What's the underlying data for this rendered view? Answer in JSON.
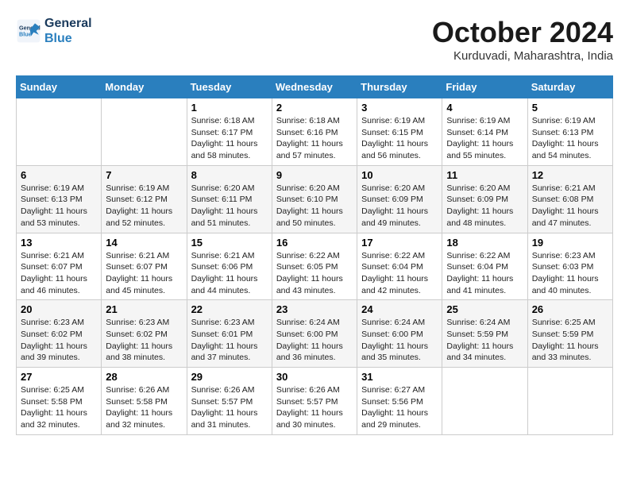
{
  "logo": {
    "line1": "General",
    "line2": "Blue"
  },
  "title": "October 2024",
  "subtitle": "Kurduvadi, Maharashtra, India",
  "days_of_week": [
    "Sunday",
    "Monday",
    "Tuesday",
    "Wednesday",
    "Thursday",
    "Friday",
    "Saturday"
  ],
  "weeks": [
    [
      {
        "day": "",
        "info": ""
      },
      {
        "day": "",
        "info": ""
      },
      {
        "day": "1",
        "info": "Sunrise: 6:18 AM\nSunset: 6:17 PM\nDaylight: 11 hours and 58 minutes."
      },
      {
        "day": "2",
        "info": "Sunrise: 6:18 AM\nSunset: 6:16 PM\nDaylight: 11 hours and 57 minutes."
      },
      {
        "day": "3",
        "info": "Sunrise: 6:19 AM\nSunset: 6:15 PM\nDaylight: 11 hours and 56 minutes."
      },
      {
        "day": "4",
        "info": "Sunrise: 6:19 AM\nSunset: 6:14 PM\nDaylight: 11 hours and 55 minutes."
      },
      {
        "day": "5",
        "info": "Sunrise: 6:19 AM\nSunset: 6:13 PM\nDaylight: 11 hours and 54 minutes."
      }
    ],
    [
      {
        "day": "6",
        "info": "Sunrise: 6:19 AM\nSunset: 6:13 PM\nDaylight: 11 hours and 53 minutes."
      },
      {
        "day": "7",
        "info": "Sunrise: 6:19 AM\nSunset: 6:12 PM\nDaylight: 11 hours and 52 minutes."
      },
      {
        "day": "8",
        "info": "Sunrise: 6:20 AM\nSunset: 6:11 PM\nDaylight: 11 hours and 51 minutes."
      },
      {
        "day": "9",
        "info": "Sunrise: 6:20 AM\nSunset: 6:10 PM\nDaylight: 11 hours and 50 minutes."
      },
      {
        "day": "10",
        "info": "Sunrise: 6:20 AM\nSunset: 6:09 PM\nDaylight: 11 hours and 49 minutes."
      },
      {
        "day": "11",
        "info": "Sunrise: 6:20 AM\nSunset: 6:09 PM\nDaylight: 11 hours and 48 minutes."
      },
      {
        "day": "12",
        "info": "Sunrise: 6:21 AM\nSunset: 6:08 PM\nDaylight: 11 hours and 47 minutes."
      }
    ],
    [
      {
        "day": "13",
        "info": "Sunrise: 6:21 AM\nSunset: 6:07 PM\nDaylight: 11 hours and 46 minutes."
      },
      {
        "day": "14",
        "info": "Sunrise: 6:21 AM\nSunset: 6:07 PM\nDaylight: 11 hours and 45 minutes."
      },
      {
        "day": "15",
        "info": "Sunrise: 6:21 AM\nSunset: 6:06 PM\nDaylight: 11 hours and 44 minutes."
      },
      {
        "day": "16",
        "info": "Sunrise: 6:22 AM\nSunset: 6:05 PM\nDaylight: 11 hours and 43 minutes."
      },
      {
        "day": "17",
        "info": "Sunrise: 6:22 AM\nSunset: 6:04 PM\nDaylight: 11 hours and 42 minutes."
      },
      {
        "day": "18",
        "info": "Sunrise: 6:22 AM\nSunset: 6:04 PM\nDaylight: 11 hours and 41 minutes."
      },
      {
        "day": "19",
        "info": "Sunrise: 6:23 AM\nSunset: 6:03 PM\nDaylight: 11 hours and 40 minutes."
      }
    ],
    [
      {
        "day": "20",
        "info": "Sunrise: 6:23 AM\nSunset: 6:02 PM\nDaylight: 11 hours and 39 minutes."
      },
      {
        "day": "21",
        "info": "Sunrise: 6:23 AM\nSunset: 6:02 PM\nDaylight: 11 hours and 38 minutes."
      },
      {
        "day": "22",
        "info": "Sunrise: 6:23 AM\nSunset: 6:01 PM\nDaylight: 11 hours and 37 minutes."
      },
      {
        "day": "23",
        "info": "Sunrise: 6:24 AM\nSunset: 6:00 PM\nDaylight: 11 hours and 36 minutes."
      },
      {
        "day": "24",
        "info": "Sunrise: 6:24 AM\nSunset: 6:00 PM\nDaylight: 11 hours and 35 minutes."
      },
      {
        "day": "25",
        "info": "Sunrise: 6:24 AM\nSunset: 5:59 PM\nDaylight: 11 hours and 34 minutes."
      },
      {
        "day": "26",
        "info": "Sunrise: 6:25 AM\nSunset: 5:59 PM\nDaylight: 11 hours and 33 minutes."
      }
    ],
    [
      {
        "day": "27",
        "info": "Sunrise: 6:25 AM\nSunset: 5:58 PM\nDaylight: 11 hours and 32 minutes."
      },
      {
        "day": "28",
        "info": "Sunrise: 6:26 AM\nSunset: 5:58 PM\nDaylight: 11 hours and 32 minutes."
      },
      {
        "day": "29",
        "info": "Sunrise: 6:26 AM\nSunset: 5:57 PM\nDaylight: 11 hours and 31 minutes."
      },
      {
        "day": "30",
        "info": "Sunrise: 6:26 AM\nSunset: 5:57 PM\nDaylight: 11 hours and 30 minutes."
      },
      {
        "day": "31",
        "info": "Sunrise: 6:27 AM\nSunset: 5:56 PM\nDaylight: 11 hours and 29 minutes."
      },
      {
        "day": "",
        "info": ""
      },
      {
        "day": "",
        "info": ""
      }
    ]
  ]
}
